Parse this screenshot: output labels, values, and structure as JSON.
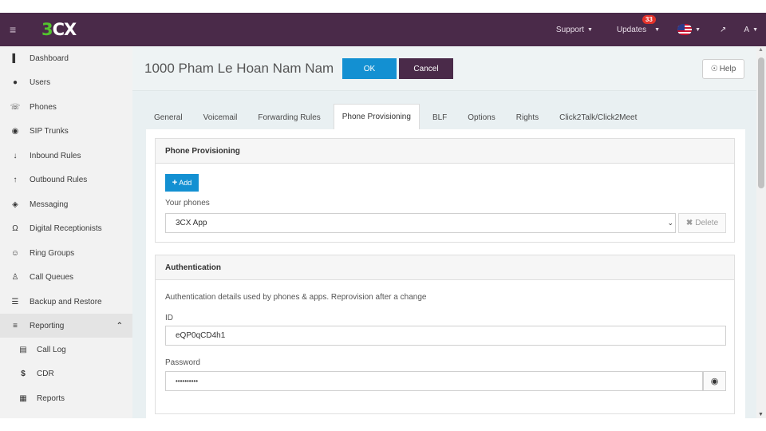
{
  "app": {
    "logo_prefix": "3",
    "logo_suffix": "CX"
  },
  "topnav": {
    "support": "Support",
    "updates": "Updates",
    "updates_count": "33",
    "user": "A"
  },
  "sidebar": {
    "items": [
      {
        "label": "Dashboard",
        "icon": "bar-chart-icon"
      },
      {
        "label": "Users",
        "icon": "user-icon"
      },
      {
        "label": "Phones",
        "icon": "phone-icon"
      },
      {
        "label": "SIP Trunks",
        "icon": "globe-icon"
      },
      {
        "label": "Inbound Rules",
        "icon": "arrow-down-icon"
      },
      {
        "label": "Outbound Rules",
        "icon": "arrow-up-icon"
      },
      {
        "label": "Messaging",
        "icon": "chat-icon"
      },
      {
        "label": "Digital Receptionists",
        "icon": "headset-icon"
      },
      {
        "label": "Ring Groups",
        "icon": "group-icon"
      },
      {
        "label": "Call Queues",
        "icon": "users-icon"
      },
      {
        "label": "Backup and Restore",
        "icon": "database-icon"
      },
      {
        "label": "Reporting",
        "icon": "list-icon"
      },
      {
        "label": "Call Log",
        "icon": "document-icon"
      },
      {
        "label": "CDR",
        "icon": "dollar-icon"
      },
      {
        "label": "Reports",
        "icon": "report-icon"
      }
    ]
  },
  "header": {
    "title": "1000 Pham Le Hoan Nam Nam",
    "ok_label": "OK",
    "cancel_label": "Cancel",
    "help_label": "Help"
  },
  "tabs": [
    {
      "label": "General"
    },
    {
      "label": "Voicemail"
    },
    {
      "label": "Forwarding Rules"
    },
    {
      "label": "Phone Provisioning"
    },
    {
      "label": "BLF"
    },
    {
      "label": "Options"
    },
    {
      "label": "Rights"
    },
    {
      "label": "Click2Talk/Click2Meet"
    }
  ],
  "provisioning": {
    "heading": "Phone Provisioning",
    "add_label": "Add",
    "phones_label": "Your phones",
    "selected_phone": "3CX App",
    "delete_label": "Delete"
  },
  "authentication": {
    "heading": "Authentication",
    "description": "Authentication details used by phones & apps. Reprovision after a change",
    "id_label": "ID",
    "id_value": "eQP0qCD4h1",
    "password_label": "Password",
    "password_value": "••••••••••"
  },
  "colors": {
    "topbar": "#4a2a49",
    "primary": "#1390d2",
    "logo_accent": "#53c32e"
  }
}
